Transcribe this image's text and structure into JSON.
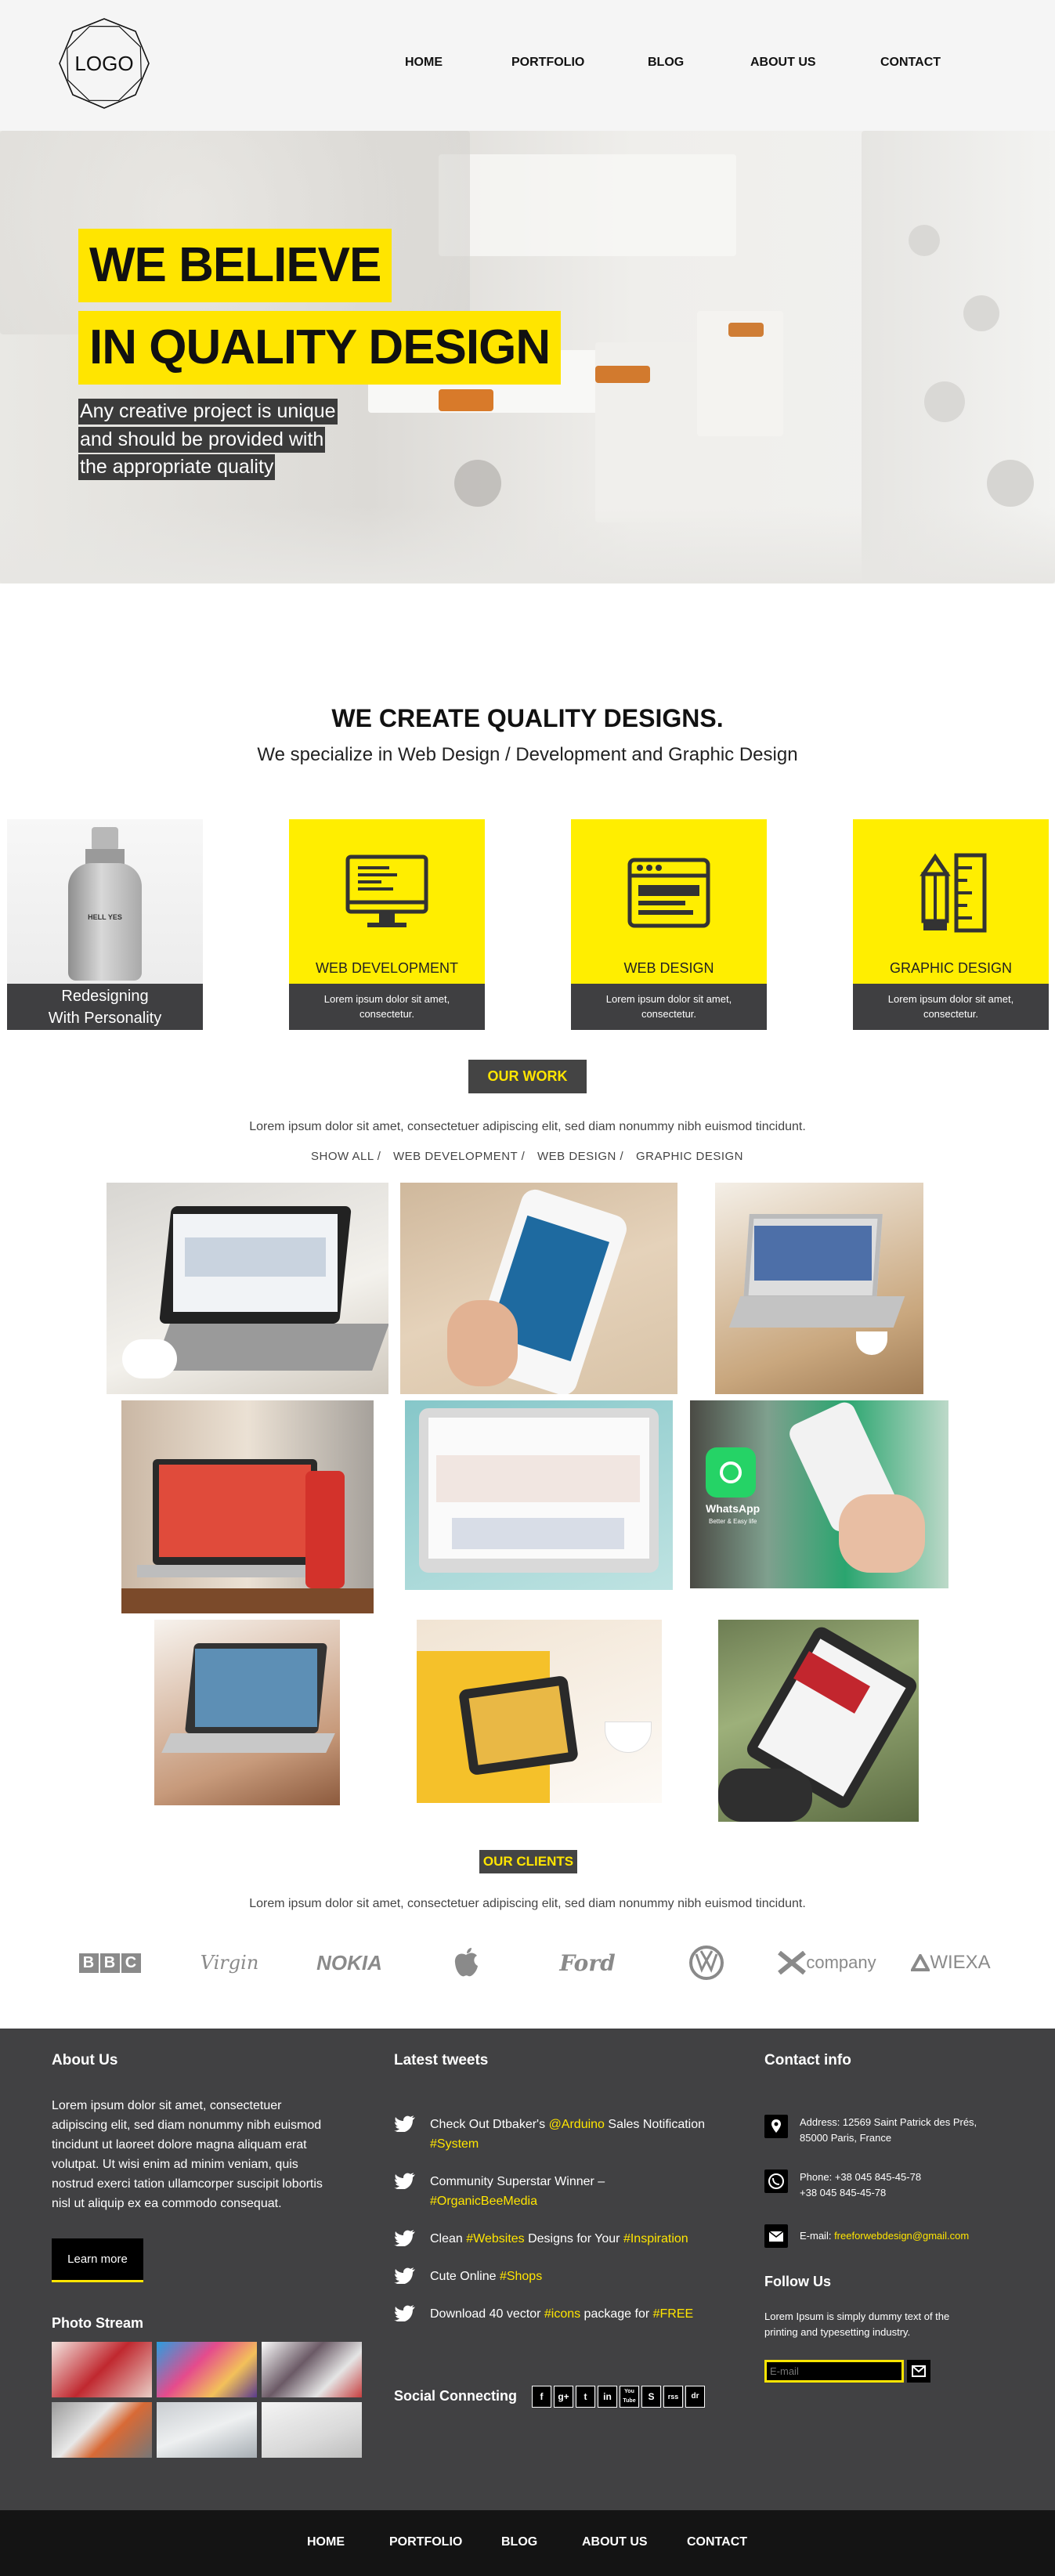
{
  "header": {
    "logo_text": "LOGO",
    "nav": [
      "HOME",
      "PORTFOLIO",
      "BLOG",
      "ABOUT US",
      "CONTACT"
    ]
  },
  "hero": {
    "title_line1": "WE BELIEVE",
    "title_line2": "IN QUALITY DESIGN",
    "sub_line1": "Any creative project is unique",
    "sub_line2": "and should be provided with",
    "sub_line3": "the appropriate quality"
  },
  "create": {
    "title": "WE CREATE QUALITY DESIGNS.",
    "subtitle": "We specialize in Web Design / Development and Graphic Design"
  },
  "services": {
    "first_line1": "Redesigning",
    "first_line2": "With Personality",
    "first_bottle_text": "HELL YES",
    "items": [
      {
        "label": "WEB DEVELOPMENT",
        "desc1": "Lorem ipsum dolor sit amet,",
        "desc2": "consectetur.",
        "icon": "monitor-icon"
      },
      {
        "label": "WEB DESIGN",
        "desc1": "Lorem ipsum dolor sit amet,",
        "desc2": "consectetur.",
        "icon": "browser-window-icon"
      },
      {
        "label": "GRAPHIC DESIGN",
        "desc1": "Lorem ipsum dolor sit amet,",
        "desc2": "consectetur.",
        "icon": "pencil-ruler-icon"
      }
    ]
  },
  "work": {
    "badge": "OUR WORK",
    "desc": "Lorem ipsum dolor sit amet, consectetuer adipiscing elit, sed diam nonummy nibh euismod tincidunt.",
    "filters": [
      "SHOW ALL /",
      "WEB DEVELOPMENT /",
      "WEB DESIGN /",
      "GRAPHIC DESIGN"
    ],
    "whatsapp_label": "WhatsApp",
    "whatsapp_sub": "Better & Easy life"
  },
  "clients": {
    "badge": "OUR CLIENTS",
    "desc": "Lorem ipsum dolor sit amet, consectetuer adipiscing elit, sed diam nonummy nibh euismod tincidunt.",
    "logos": [
      "BBC",
      "Virgin",
      "NOKIA",
      "apple",
      "Ford",
      "VW",
      "company",
      "WIEXA"
    ]
  },
  "footer": {
    "about_title": "About Us",
    "about_text": [
      "Lorem ipsum dolor sit amet, consectetuer",
      "adipiscing elit, sed diam nonummy nibh euismod",
      "tincidunt ut laoreet dolore magna aliquam erat",
      "volutpat. Ut wisi enim ad minim veniam, quis",
      "nostrud exerci tation ullamcorper suscipit lobortis",
      "nisl ut aliquip ex ea commodo consequat."
    ],
    "learn_more": "Learn more",
    "photo_title": "Photo Stream",
    "tweets_title": "Latest tweets",
    "tweets": [
      {
        "a": "Check Out Dtbaker's ",
        "b": "@Arduino",
        "c": " Sales Notification",
        "d": "#System",
        "e": ""
      },
      {
        "a": "Community Superstar Winner –",
        "b": "",
        "c": "",
        "d": "#OrganicBeeMedia",
        "e": ""
      },
      {
        "a": "Clean ",
        "b": "#Websites",
        "c": " Designs for Your ",
        "d": "#Inspiration",
        "e": ""
      },
      {
        "a": "Cute Online ",
        "b": "#Shops",
        "c": "",
        "d": "",
        "e": ""
      },
      {
        "a": "Download 40 vector ",
        "b": "#icons",
        "c": " package for ",
        "d": "#FREE",
        "e": ""
      }
    ],
    "social_title": "Social Connecting",
    "social_icons": [
      "f",
      "g+",
      "t",
      "in",
      "You\nTube",
      "S",
      "rss",
      "dr"
    ],
    "contact_title": "Contact info",
    "address_line1": "Address: 12569 Saint Patrick des Prés,",
    "address_line2": "85000 Paris, France",
    "phone_line1": "Phone: +38 045 845-45-78",
    "phone_line2": "+38 045 845-45-78",
    "email_label": "E-mail: ",
    "email_value": "freeforwebdesign@gmail.com",
    "follow_title": "Follow Us",
    "follow_line1": "Lorem Ipsum is simply dummy text of the",
    "follow_line2": "printing and typesetting industry.",
    "email_placeholder": "E-mail"
  },
  "bottom_nav": [
    "HOME",
    "PORTFOLIO",
    "BLOG",
    "ABOUT US",
    "CONTACT"
  ],
  "colors": {
    "accent": "#ffe500",
    "dark": "#414143",
    "bottom": "#141414",
    "header": "#f5f5f5"
  }
}
